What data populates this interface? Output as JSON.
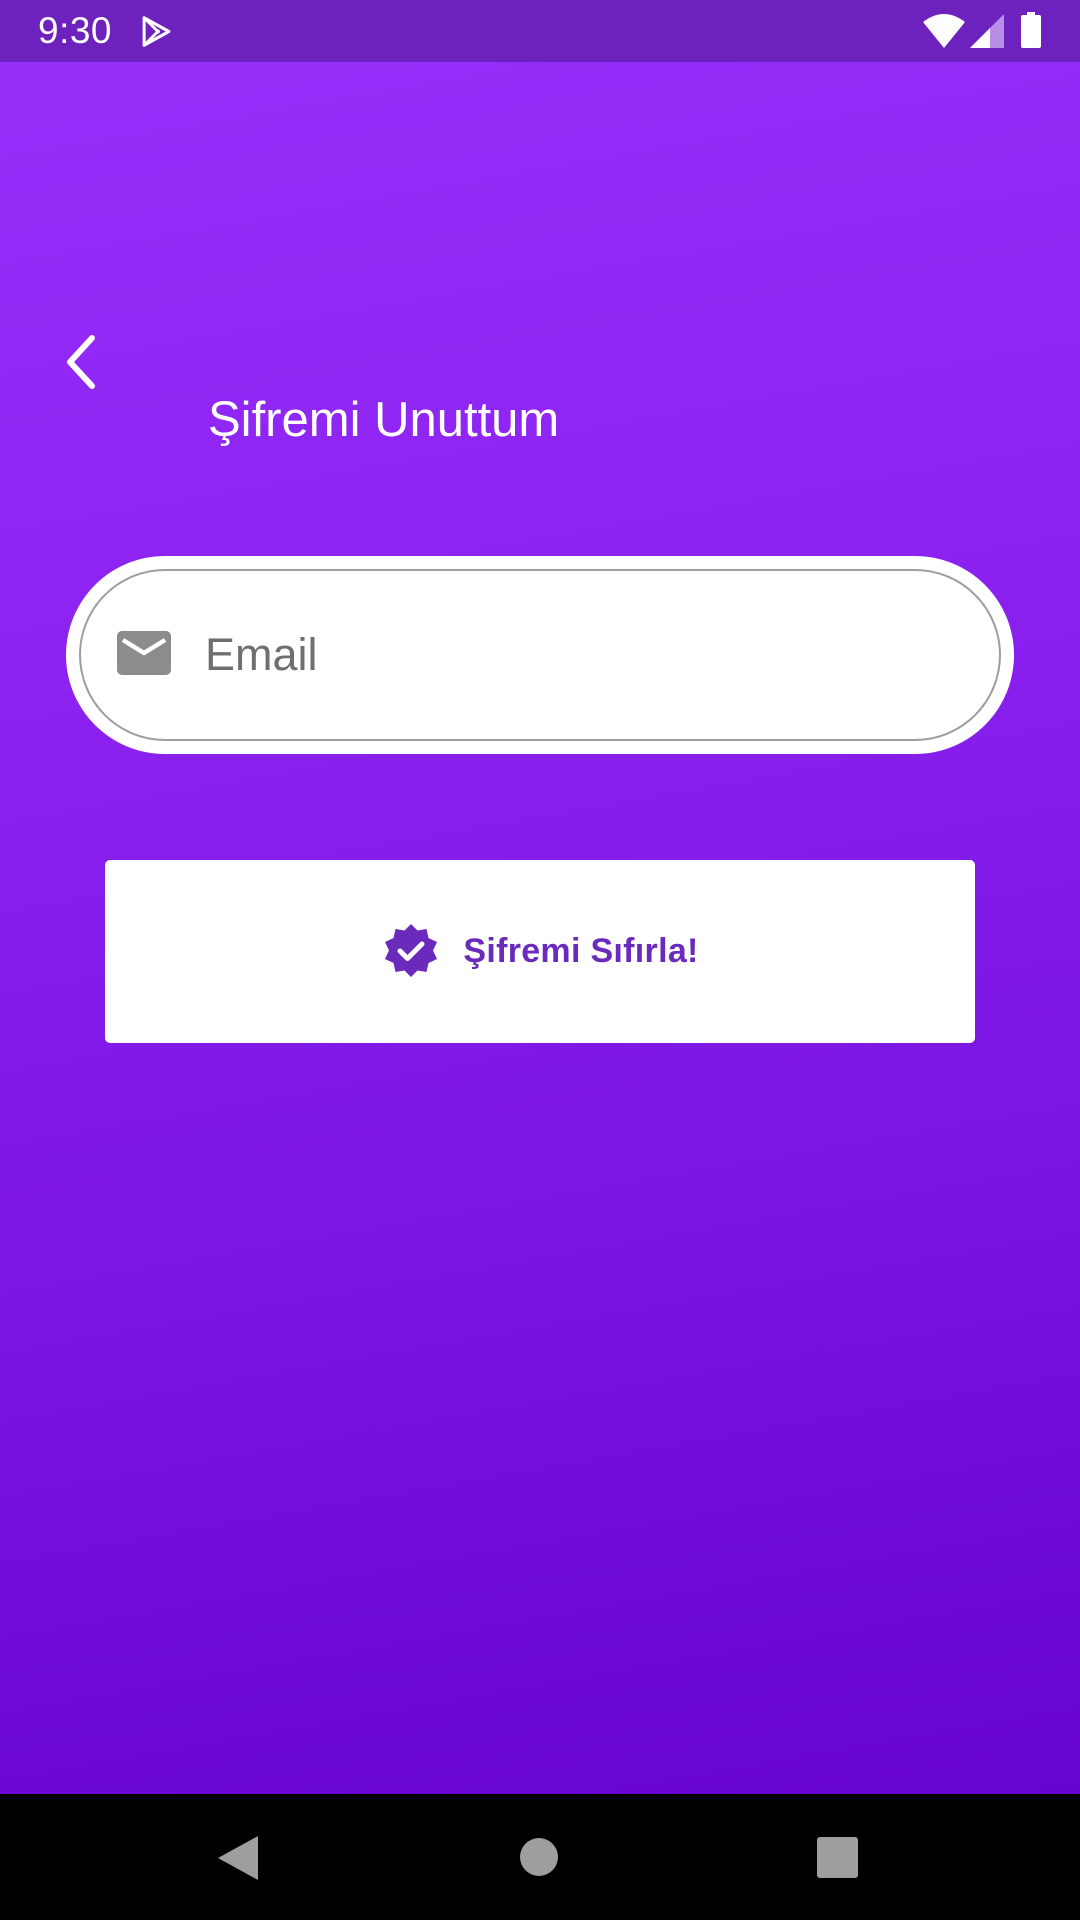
{
  "status_bar": {
    "time": "9:30",
    "icons": [
      "play-store-icon",
      "wifi-icon",
      "cell-signal-icon",
      "battery-icon"
    ]
  },
  "header": {
    "back_icon": "chevron-left-icon",
    "title": "Şifremi Unuttum"
  },
  "email_field": {
    "icon": "mail-icon",
    "placeholder": "Email",
    "value": ""
  },
  "reset_button": {
    "icon": "verified-badge-icon",
    "label": "Şifremi Sıfırla!"
  },
  "navigation_bar": {
    "icons": [
      "nav-back-icon",
      "nav-home-icon",
      "nav-recents-icon"
    ]
  },
  "colors": {
    "status_bar": "#6e22bd",
    "gradient_top": "#972ffb",
    "gradient_bottom": "#6503d1",
    "button_text": "#6a2bbd",
    "field_border": "#9e9e9e",
    "nav_bar": "#000000"
  }
}
